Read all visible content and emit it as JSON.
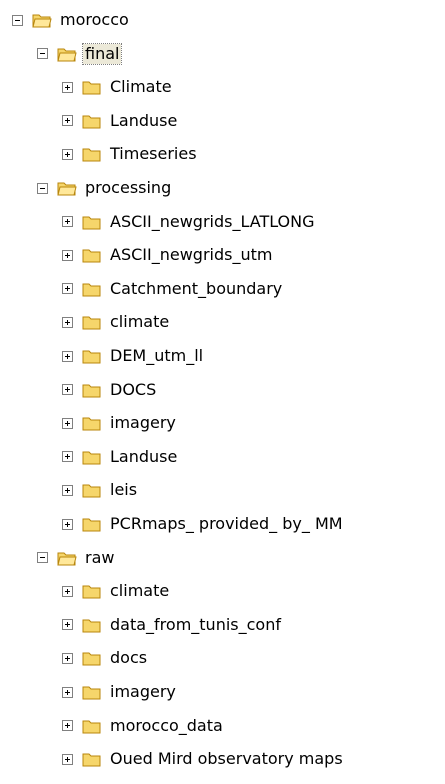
{
  "tree": {
    "root": {
      "label": "morocco",
      "toggle": "collapse-icon",
      "icon": "folder-open-icon",
      "children": [
        {
          "label": "final",
          "toggle": "collapse-icon",
          "icon": "folder-open-icon",
          "selected": true,
          "children": [
            {
              "label": "Climate",
              "toggle": "expand-icon",
              "icon": "folder-icon"
            },
            {
              "label": "Landuse",
              "toggle": "expand-icon",
              "icon": "folder-icon"
            },
            {
              "label": "Timeseries",
              "toggle": "expand-icon",
              "icon": "folder-icon"
            }
          ]
        },
        {
          "label": "processing",
          "toggle": "collapse-icon",
          "icon": "folder-open-icon",
          "children": [
            {
              "label": "ASCII_newgrids_LATLONG",
              "toggle": "expand-icon",
              "icon": "folder-icon"
            },
            {
              "label": "ASCII_newgrids_utm",
              "toggle": "expand-icon",
              "icon": "folder-icon"
            },
            {
              "label": "Catchment_boundary",
              "toggle": "expand-icon",
              "icon": "folder-icon"
            },
            {
              "label": "climate",
              "toggle": "expand-icon",
              "icon": "folder-icon"
            },
            {
              "label": "DEM_utm_ll",
              "toggle": "expand-icon",
              "icon": "folder-icon"
            },
            {
              "label": "DOCS",
              "toggle": "expand-icon",
              "icon": "folder-icon"
            },
            {
              "label": "imagery",
              "toggle": "expand-icon",
              "icon": "folder-icon"
            },
            {
              "label": "Landuse",
              "toggle": "expand-icon",
              "icon": "folder-icon"
            },
            {
              "label": "leis",
              "toggle": "expand-icon",
              "icon": "folder-icon"
            },
            {
              "label": "PCRmaps_ provided_ by_ MM",
              "toggle": "expand-icon",
              "icon": "folder-icon"
            }
          ]
        },
        {
          "label": "raw",
          "toggle": "collapse-icon",
          "icon": "folder-open-icon",
          "children": [
            {
              "label": "climate",
              "toggle": "expand-icon",
              "icon": "folder-icon"
            },
            {
              "label": "data_from_tunis_conf",
              "toggle": "expand-icon",
              "icon": "folder-icon"
            },
            {
              "label": "docs",
              "toggle": "expand-icon",
              "icon": "folder-icon"
            },
            {
              "label": "imagery",
              "toggle": "expand-icon",
              "icon": "folder-icon"
            },
            {
              "label": "morocco_data",
              "toggle": "expand-icon",
              "icon": "folder-icon"
            },
            {
              "label": "Oued Mird observatory maps",
              "toggle": "expand-icon",
              "icon": "folder-icon"
            }
          ]
        }
      ]
    }
  },
  "colors": {
    "folder_fill": "#f6d66b",
    "folder_outline": "#b8860b",
    "toggle_border": "#808080",
    "selection_bg": "#ece9d8"
  }
}
